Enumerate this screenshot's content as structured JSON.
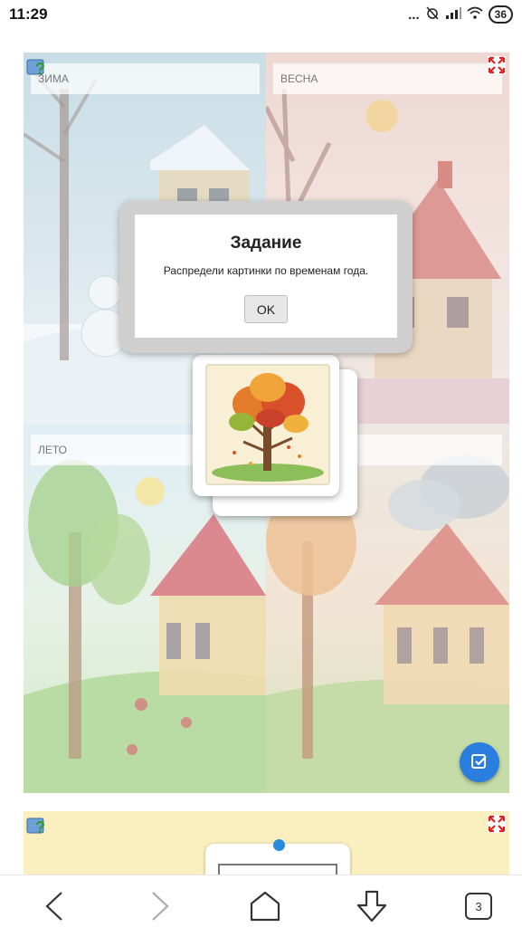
{
  "status_bar": {
    "time": "11:29",
    "dots": "...",
    "battery": "36"
  },
  "task": {
    "seasons": {
      "winter": "ЗИМА",
      "spring": "ВЕСНА",
      "summer": "ЛЕТО",
      "autumn": ""
    },
    "dialog": {
      "title": "Задание",
      "message": "Распредели картинки по временам года.",
      "ok_label": "OK"
    },
    "cards": [
      "autumn-tree-image"
    ]
  },
  "icons": {
    "help": "help-icon",
    "fullscreen": "fullscreen-icon",
    "check": "check-icon",
    "back": "back-arrow-icon",
    "forward": "forward-arrow-icon",
    "home": "home-icon",
    "download": "download-icon"
  },
  "colors": {
    "accent": "#2a7ee0",
    "widget2_bg": "#faf0bf"
  },
  "nav": {
    "tabs_count": "3"
  }
}
